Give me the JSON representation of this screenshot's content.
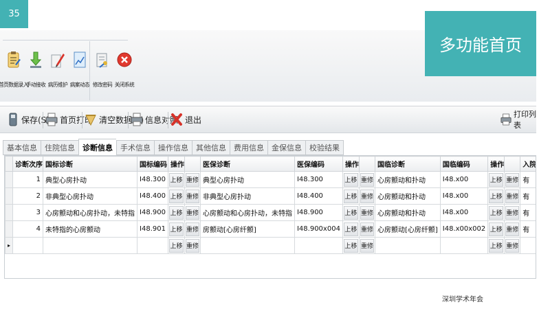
{
  "slide": {
    "number": "35",
    "title": "多功能首页",
    "footer": "深圳学术年会"
  },
  "ribbon": {
    "buttons": [
      {
        "label": "首页数据录入",
        "icon": "clipboard-edit-icon"
      },
      {
        "label": "手动接收",
        "icon": "download-arrow-icon"
      },
      {
        "label": "病历维护",
        "icon": "pencil-paper-icon"
      },
      {
        "label": "病案动态",
        "icon": "chart-icon"
      },
      {
        "label": "修改密码",
        "icon": "key-document-icon"
      },
      {
        "label": "关闭系统",
        "icon": "close-circle-icon"
      }
    ]
  },
  "toolbar": {
    "save": "保存(S)",
    "print_home": "首页打印",
    "clear": "清空数据(K)",
    "compare": "信息对照",
    "exit": "退出",
    "print_list": "打印列表"
  },
  "tabs": [
    "基本信息",
    "住院信息",
    "诊断信息",
    "手术信息",
    "操作信息",
    "其他信息",
    "费用信息",
    "金保信息",
    "校验结果"
  ],
  "active_tab": "诊断信息",
  "grid": {
    "columns": [
      "诊断次序",
      "国标诊断",
      "国标编码",
      "操作",
      "",
      "医保诊断",
      "医保编码",
      "操作",
      "",
      "国临诊断",
      "国临编码",
      "操作",
      "",
      "入院病情"
    ],
    "btn_up": "上移",
    "btn_edit": "重修",
    "rows": [
      {
        "order": "1",
        "gb_diag": "典型心房扑动",
        "gb_code": "I48.300",
        "yb_diag": "典型心房扑动",
        "yb_code": "I48.300",
        "gl_diag": "心房颤动和扑动",
        "gl_code": "I48.x00",
        "status": "有"
      },
      {
        "order": "2",
        "gb_diag": "非典型心房扑动",
        "gb_code": "I48.400",
        "yb_diag": "非典型心房扑动",
        "yb_code": "I48.400",
        "gl_diag": "心房颤动和扑动",
        "gl_code": "I48.x00",
        "status": "有"
      },
      {
        "order": "3",
        "gb_diag": "心房颤动和心房扑动，未特指",
        "gb_code": "I48.900",
        "yb_diag": "心房颤动和心房扑动，未特指",
        "yb_code": "I48.900",
        "gl_diag": "心房颤动和扑动",
        "gl_code": "I48.x00",
        "status": "有"
      },
      {
        "order": "4",
        "gb_diag": "未特指的心房颤动",
        "gb_code": "I48.901",
        "yb_diag": "房颤动[心房纤颤]",
        "yb_code": "I48.900x004",
        "gl_diag": "心房颤动[心房纤颤]",
        "gl_code": "I48.x00x002",
        "status": "有"
      }
    ]
  }
}
